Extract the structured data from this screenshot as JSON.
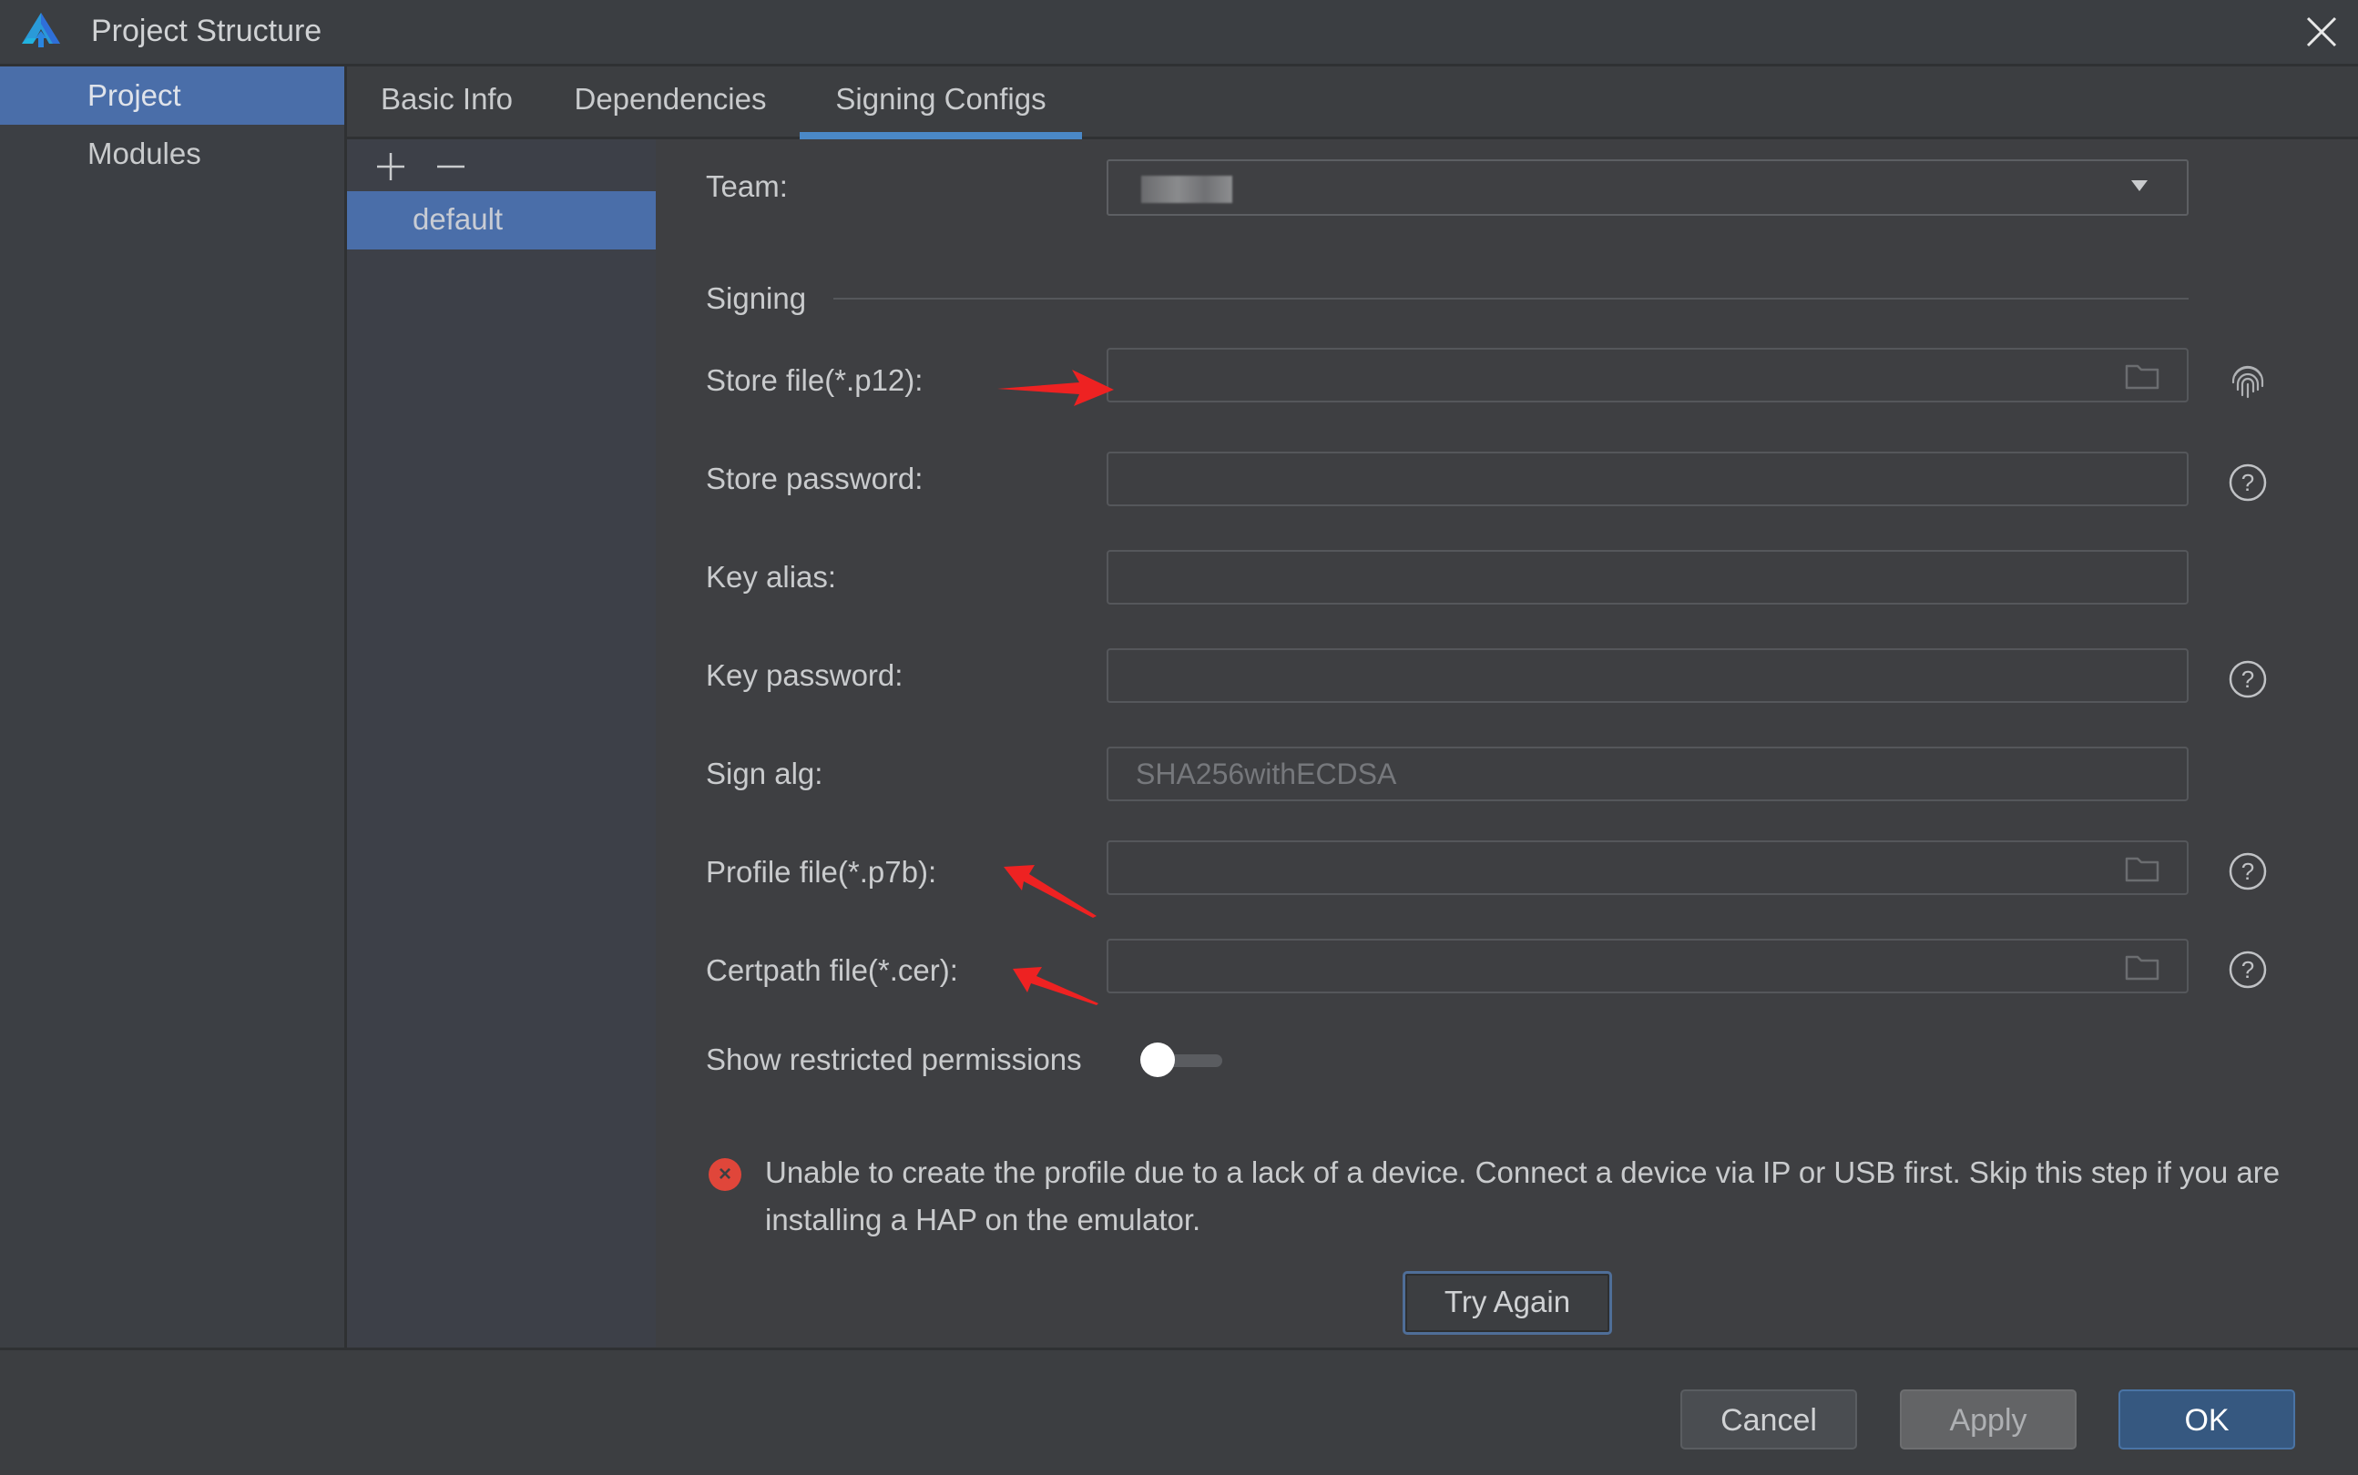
{
  "window": {
    "title": "Project Structure",
    "logo_icon": "deveco-logo-icon",
    "close_icon": "close-icon"
  },
  "sidebar": {
    "items": [
      {
        "label": "Project",
        "selected": true
      },
      {
        "label": "Modules",
        "selected": false
      }
    ]
  },
  "tabs": [
    {
      "label": "Basic Info",
      "active": false
    },
    {
      "label": "Dependencies",
      "active": false
    },
    {
      "label": "Signing Configs",
      "active": true
    }
  ],
  "config_list": {
    "add_icon": "plus-icon",
    "remove_icon": "minus-icon",
    "items": [
      {
        "label": "default",
        "selected": true
      }
    ]
  },
  "form": {
    "team": {
      "label": "Team:",
      "value": "(redacted)"
    },
    "signing_section": "Signing",
    "fields": [
      {
        "label": "Store file(*.p12):",
        "value": "",
        "has_folder": true,
        "side_icon": "fingerprint-icon"
      },
      {
        "label": "Store password:",
        "value": "",
        "has_folder": false,
        "side_icon": "help-icon"
      },
      {
        "label": "Key alias:",
        "value": "",
        "has_folder": false,
        "side_icon": ""
      },
      {
        "label": "Key password:",
        "value": "",
        "has_folder": false,
        "side_icon": "help-icon"
      },
      {
        "label": "Sign alg:",
        "value": "SHA256withECDSA",
        "disabled": true,
        "side_icon": ""
      },
      {
        "label": "Profile file(*.p7b):",
        "value": "",
        "has_folder": true,
        "side_icon": "help-icon"
      },
      {
        "label": "Certpath file(*.cer):",
        "value": "",
        "has_folder": true,
        "side_icon": "help-icon"
      }
    ],
    "show_restricted_permissions": {
      "label": "Show restricted permissions",
      "enabled": false
    },
    "error": {
      "icon": "error-icon",
      "message": "Unable to create the profile due to a lack of a device. Connect a device via IP or USB first. Skip this step if you are installing a HAP on the emulator.",
      "color": "#e0463a"
    },
    "try_again_label": "Try Again"
  },
  "footer": {
    "cancel_label": "Cancel",
    "apply_label": "Apply",
    "ok_label": "OK"
  },
  "colors": {
    "selection": "#4a6ea9",
    "tab_underline": "#4a88c7",
    "primary_button": "#365880",
    "annotation_arrow": "#ee2222"
  }
}
